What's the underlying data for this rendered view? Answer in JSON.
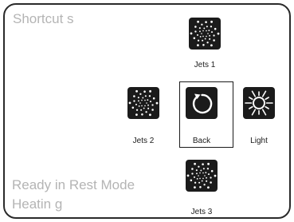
{
  "screen": {
    "title": "Shortcut s",
    "status_line_1": "Ready in Rest Mode",
    "status_line_2": "Heatin g"
  },
  "buttons": {
    "jets1": {
      "label": "Jets 1",
      "icon": "jets-icon"
    },
    "jets2": {
      "label": "Jets 2",
      "icon": "jets-icon"
    },
    "back": {
      "label": "Back",
      "icon": "back-arrow-icon"
    },
    "light": {
      "label": "Light",
      "icon": "light-sun-icon"
    },
    "jets3": {
      "label": "Jets 3",
      "icon": "jets-icon"
    }
  },
  "colors": {
    "background": "#ffffff",
    "tile": "#1b1b1b",
    "muted_text": "#b4b4b4",
    "border": "#2a2a2a"
  }
}
